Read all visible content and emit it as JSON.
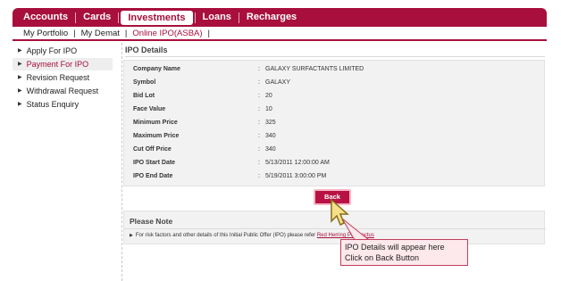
{
  "top_nav": {
    "tabs": [
      {
        "label": "Accounts"
      },
      {
        "label": "Cards"
      },
      {
        "label": "Investments"
      },
      {
        "label": "Loans"
      },
      {
        "label": "Recharges"
      }
    ]
  },
  "sub_nav": {
    "items": [
      {
        "label": "My Portfolio"
      },
      {
        "label": "My Demat"
      },
      {
        "label": "Online IPO(ASBA)"
      }
    ]
  },
  "sidebar": {
    "items": [
      {
        "label": "Apply For IPO"
      },
      {
        "label": "Payment For IPO"
      },
      {
        "label": "Revision Request"
      },
      {
        "label": "Withdrawal Request"
      },
      {
        "label": "Status Enquiry"
      }
    ]
  },
  "main": {
    "title": "IPO Details",
    "details": [
      {
        "label": "Company Name",
        "value": "GALAXY SURFACTANTS LIMITED"
      },
      {
        "label": "Symbol",
        "value": "GALAXY"
      },
      {
        "label": "Bid Lot",
        "value": "20"
      },
      {
        "label": "Face Value",
        "value": "10"
      },
      {
        "label": "Minimum Price",
        "value": "325"
      },
      {
        "label": "Maximum Price",
        "value": "340"
      },
      {
        "label": "Cut Off Price",
        "value": "340"
      },
      {
        "label": "IPO Start Date",
        "value": "5/13/2011 12:00:00 AM"
      },
      {
        "label": "IPO End Date",
        "value": "5/19/2011 3:00:00 PM"
      }
    ],
    "colon": ":",
    "back_label": "Back"
  },
  "note": {
    "title": "Please Note",
    "text": "For risk factors and other details of this Initial Public Offer (IPO) please refer",
    "link": "Red Herring Prospectus"
  },
  "callout": {
    "line1": "IPO Details will appear here",
    "line2": "Click on Back Button"
  },
  "colors": {
    "brand": "#a80f3c",
    "button": "#b81244",
    "callout_bg": "#fde8ec"
  }
}
